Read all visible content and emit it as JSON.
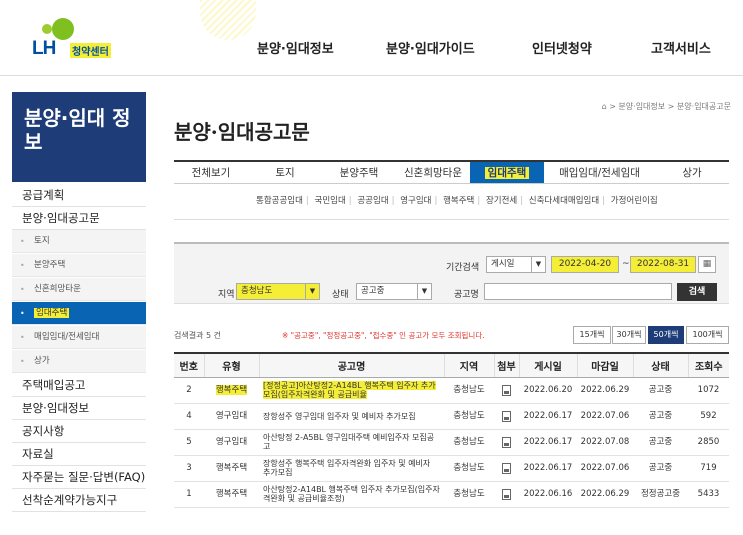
{
  "header": {
    "logo_main": "LH",
    "logo_sub": "청약센터",
    "nav": [
      "분양·임대정보",
      "분양·임대가이드",
      "인터넷청약",
      "고객서비스"
    ]
  },
  "sidebar": {
    "title": "분양·임대 정보",
    "items": [
      {
        "label": "공급계획",
        "type": "big"
      },
      {
        "label": "분양·임대공고문",
        "type": "big"
      },
      {
        "label": "토지",
        "type": "sub"
      },
      {
        "label": "분양주택",
        "type": "sub"
      },
      {
        "label": "신혼희망타운",
        "type": "sub"
      },
      {
        "label": "임대주택",
        "type": "sub-active"
      },
      {
        "label": "매입임대/전세임대",
        "type": "sub"
      },
      {
        "label": "상가",
        "type": "sub"
      },
      {
        "label": "주택매입공고",
        "type": "big"
      },
      {
        "label": "분양·임대정보",
        "type": "big"
      },
      {
        "label": "공지사항",
        "type": "big"
      },
      {
        "label": "자료실",
        "type": "big"
      },
      {
        "label": "자주묻는 질문·답변(FAQ)",
        "type": "big"
      },
      {
        "label": "선착순계약가능지구",
        "type": "big"
      }
    ]
  },
  "breadcrumb": "> 분양·임대정보 > 분양·임대공고문",
  "page_title": "분양·임대공고문",
  "tabs": [
    "전체보기",
    "토지",
    "분양주택",
    "신혼희망타운",
    "임대주택",
    "매입임대/전세임대",
    "상가"
  ],
  "active_tab": "임대주택",
  "subtabs": [
    "통합공공임대",
    "국민임대",
    "공공임대",
    "영구임대",
    "행복주택",
    "장기전세",
    "신축다세대매입임대",
    "가정어린이집"
  ],
  "search": {
    "period_label": "기간검색",
    "period_type": "게시일",
    "date_from": "2022-04-20",
    "date_sep": "~",
    "date_to": "2022-08-31",
    "region_label": "지역",
    "region_value": "충청남도",
    "status_label": "상태",
    "status_value": "공고중",
    "name_label": "공고명",
    "name_value": "",
    "button": "검색"
  },
  "result_count": "검색결과 5 건",
  "notice_prefix": "※ \"공고중\", \"정정공고중\", \"접수중\" 인 공고가 모두 조회됩니다.",
  "per_page": [
    "15개씩",
    "30개씩",
    "50개씩",
    "100개씩"
  ],
  "per_page_active": "50개씩",
  "table": {
    "headers": [
      "번호",
      "유형",
      "공고명",
      "지역",
      "첨부",
      "게시일",
      "마감일",
      "상태",
      "조회수"
    ],
    "rows": [
      {
        "no": "2",
        "type": "행복주택",
        "title": "[정정공고]아산탕정2-A14BL 행복주택 입주자 추가모집(입주자격완화 및 공급비율",
        "region": "충청남도",
        "posted": "2022.06.20",
        "deadline": "2022.06.29",
        "status": "공고중",
        "views": "1072",
        "hl": true
      },
      {
        "no": "4",
        "type": "영구임대",
        "title": "장항성주 영구임대 입주자 및 예비자 추가모집",
        "region": "충청남도",
        "posted": "2022.06.17",
        "deadline": "2022.07.06",
        "status": "공고중",
        "views": "592",
        "hl": false
      },
      {
        "no": "5",
        "type": "영구임대",
        "title": "아산탕정 2-A5BL 영구임대주택 예비입주자 모집공고",
        "region": "충청남도",
        "posted": "2022.06.17",
        "deadline": "2022.07.08",
        "status": "공고중",
        "views": "2850",
        "hl": false
      },
      {
        "no": "3",
        "type": "행복주택",
        "title": "장항성주 행복주택 입주자격완화 입주자 및 예비자 추가모집",
        "region": "충청남도",
        "posted": "2022.06.17",
        "deadline": "2022.07.06",
        "status": "공고중",
        "views": "719",
        "hl": false
      },
      {
        "no": "1",
        "type": "행복주택",
        "title": "아산탕정2-A14BL 행복주택 입주자 추가모집(입주자격완화 및 공급비율조정)",
        "region": "충청남도",
        "posted": "2022.06.16",
        "deadline": "2022.06.29",
        "status": "정정공고중",
        "views": "5433",
        "hl": false
      }
    ]
  },
  "colors": {
    "navy": "#1d3c78",
    "blue": "#0a64b4",
    "highlight": "#f5ee37",
    "notice": "#e0342e"
  }
}
